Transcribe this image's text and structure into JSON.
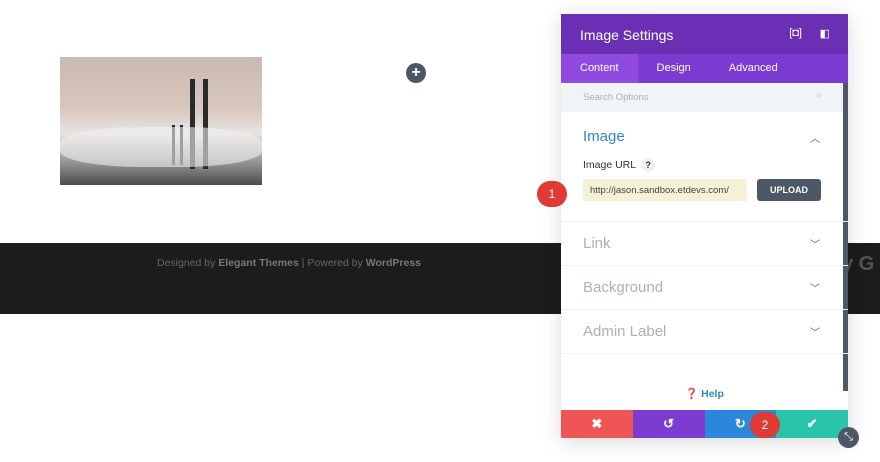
{
  "footer": {
    "prefix": "Designed by ",
    "brand": "Elegant Themes",
    "sep": " | Powered by ",
    "platform": "WordPress"
  },
  "modal": {
    "title": "Image Settings",
    "tabs": [
      {
        "label": "Content"
      },
      {
        "label": "Design"
      },
      {
        "label": "Advanced"
      }
    ],
    "search_placeholder": "Search Options",
    "image_section": {
      "title": "Image",
      "field_label": "Image URL",
      "help": "?",
      "url_value": "http://jason.sandbox.etdevs.com/",
      "upload_label": "UPLOAD"
    },
    "sections": [
      {
        "title": "Link"
      },
      {
        "title": "Background"
      },
      {
        "title": "Admin Label"
      }
    ],
    "help_label": "Help"
  },
  "annotations": {
    "one": "1",
    "two": "2"
  },
  "colors": {
    "header": "#6a2fb5",
    "cancel": "#ef5555",
    "undo": "#7e3bd0",
    "redo": "#2b87da",
    "save": "#29c4a9"
  }
}
